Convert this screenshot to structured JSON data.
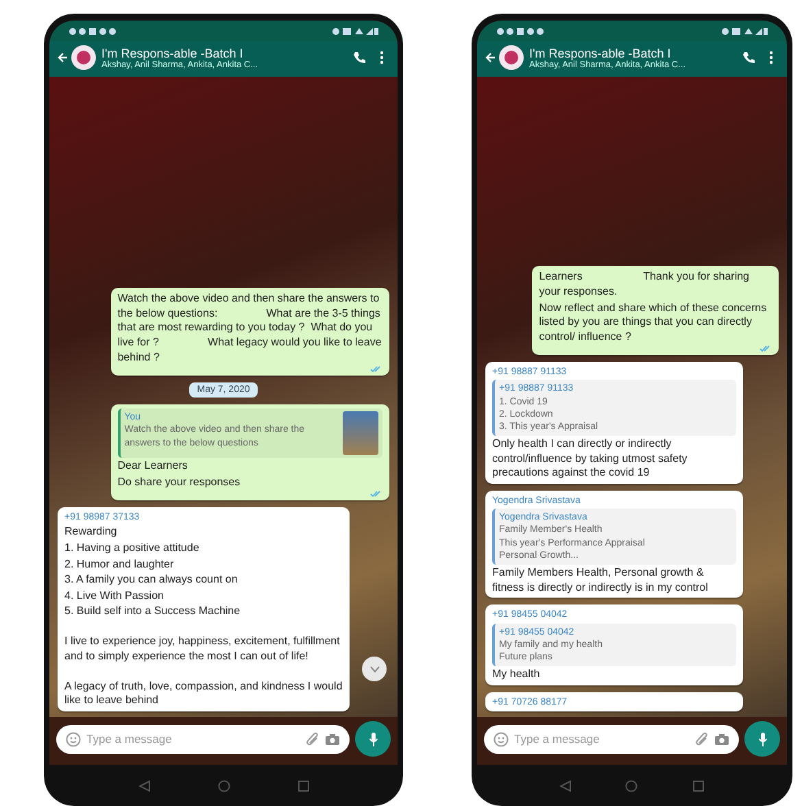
{
  "phones": [
    {
      "chat": {
        "title": "I'm Respons-able -Batch I",
        "subtitle": "Akshay, Anil Sharma, Ankita, Ankita C..."
      },
      "messages": [
        {
          "kind": "outgoing",
          "lines": [
            "Watch the above video and then share the answers to the below questions:                What are the 3-5 things that are most rewarding to you today ?  What do you live for ?                What legacy would you like to leave behind ?"
          ]
        },
        {
          "kind": "date",
          "text": "May 7, 2020"
        },
        {
          "kind": "outgoing",
          "quote": {
            "author": "You",
            "lines": [
              "Watch the above video and then share the answers to the below questions"
            ],
            "thumbnail": true
          },
          "lines": [
            "Dear Learners",
            "Do share your responses"
          ]
        },
        {
          "kind": "incoming",
          "sender": "+91 98987 37133",
          "lines": [
            "Rewarding",
            "1. Having a positive attitude",
            "2. Humor and laughter",
            "3. A family you can always count on",
            "4. Live With Passion",
            "5. Build self into a Success Machine"
          ],
          "more_paragraphs": [
            "I live to experience joy, happiness, excitement, fulfillment and to simply experience the most I can out of life!",
            "A legacy of truth, love, compassion, and kindness I would like to leave behind"
          ]
        }
      ],
      "scroll_button": true,
      "composer": {
        "placeholder": "Type a message"
      }
    },
    {
      "chat": {
        "title": "I'm Respons-able -Batch I",
        "subtitle": "Akshay, Anil Sharma, Ankita, Ankita C..."
      },
      "messages": [
        {
          "kind": "outgoing",
          "lines": [
            "Learners                    Thank you for sharing your responses.",
            "Now reflect and share which of these concerns listed by you are things that you can directly control/ influence ?"
          ]
        },
        {
          "kind": "incoming",
          "sender": "+91 98887 91133",
          "quote": {
            "author": "+91 98887 91133",
            "lines": [
              "1. Covid 19",
              "2. Lockdown",
              "3. This year's Appraisal"
            ]
          },
          "lines": [
            "Only health I can directly or indirectly control/influence by taking utmost safety precautions against the covid 19"
          ]
        },
        {
          "kind": "incoming",
          "sender": "Yogendra Srivastava",
          "quote": {
            "author": "Yogendra Srivastava",
            "lines": [
              "Family Member's Health",
              "This year's Performance Appraisal",
              "Personal Growth..."
            ]
          },
          "lines": [
            "Family Members Health, Personal growth & fitness is directly or indirectly is in my control"
          ]
        },
        {
          "kind": "incoming",
          "sender": "+91 98455 04042",
          "quote": {
            "author": "+91 98455 04042",
            "lines": [
              "My family and my health",
              "Future plans"
            ]
          },
          "lines": [
            "My health"
          ]
        },
        {
          "kind": "incoming",
          "sender": "+91 70726 88177"
        }
      ],
      "scroll_button": false,
      "composer": {
        "placeholder": "Type a message"
      }
    }
  ]
}
